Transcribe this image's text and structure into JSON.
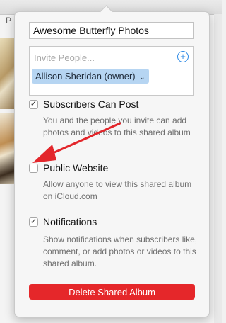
{
  "background": {
    "label": "P"
  },
  "popover": {
    "album_name": "Awesome Butterfly Photos",
    "invite": {
      "placeholder": "Invite People...",
      "add_icon": "plus-circle-icon",
      "owner": "Allison Sheridan (owner)",
      "owner_chevron": "⌄"
    },
    "options": [
      {
        "title": "Subscribers Can Post",
        "checked": true,
        "description": "You and the people you invite can add photos and videos to this shared album"
      },
      {
        "title": "Public Website",
        "checked": false,
        "description": "Allow anyone to view this shared album on iCloud.com"
      },
      {
        "title": "Notifications",
        "checked": true,
        "description": "Show notifications when subscribers like, comment, or add photos or videos to this shared album."
      }
    ],
    "delete_label": "Delete Shared Album",
    "colors": {
      "accent": "#2f8be6",
      "danger": "#e5272a",
      "annotation": "#e3262b"
    }
  }
}
